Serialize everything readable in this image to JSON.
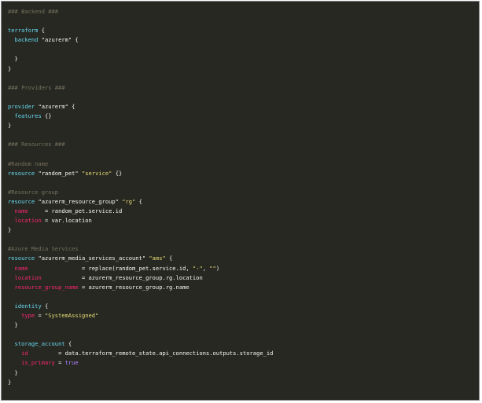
{
  "colors": {
    "background": "#272822",
    "border": "#8a8a8a",
    "plain": "#f8f8f2",
    "comment": "#75715e",
    "keyword": "#66d9ef",
    "string": "#e6db74",
    "attribute": "#f92672",
    "boolean": "#ae81ff"
  },
  "code_lines": [
    [
      {
        "t": "comment",
        "v": "### Backend ###"
      }
    ],
    [],
    [
      {
        "t": "keyword",
        "v": "terraform"
      },
      {
        "t": "plain",
        "v": " {"
      }
    ],
    [
      {
        "t": "plain",
        "v": "  "
      },
      {
        "t": "keyword",
        "v": "backend"
      },
      {
        "t": "plain",
        "v": " "
      },
      {
        "t": "plain",
        "v": "\"azurerm\""
      },
      {
        "t": "plain",
        "v": " {"
      }
    ],
    [],
    [
      {
        "t": "plain",
        "v": "  }"
      }
    ],
    [
      {
        "t": "plain",
        "v": "}"
      }
    ],
    [],
    [
      {
        "t": "comment",
        "v": "### Providers ###"
      }
    ],
    [],
    [
      {
        "t": "keyword",
        "v": "provider"
      },
      {
        "t": "plain",
        "v": " "
      },
      {
        "t": "plain",
        "v": "\"azurerm\""
      },
      {
        "t": "plain",
        "v": " {"
      }
    ],
    [
      {
        "t": "plain",
        "v": "  "
      },
      {
        "t": "keyword",
        "v": "features"
      },
      {
        "t": "plain",
        "v": " {}"
      }
    ],
    [
      {
        "t": "plain",
        "v": "}"
      }
    ],
    [],
    [
      {
        "t": "comment",
        "v": "### Resources ###"
      }
    ],
    [],
    [
      {
        "t": "comment",
        "v": "#Random name"
      }
    ],
    [
      {
        "t": "keyword",
        "v": "resource"
      },
      {
        "t": "plain",
        "v": " "
      },
      {
        "t": "plain",
        "v": "\"random_pet\""
      },
      {
        "t": "plain",
        "v": " "
      },
      {
        "t": "string",
        "v": "\"service\""
      },
      {
        "t": "plain",
        "v": " {}"
      }
    ],
    [],
    [
      {
        "t": "comment",
        "v": "#Resource group"
      }
    ],
    [
      {
        "t": "keyword",
        "v": "resource"
      },
      {
        "t": "plain",
        "v": " "
      },
      {
        "t": "plain",
        "v": "\"azurerm_resource_group\""
      },
      {
        "t": "plain",
        "v": " "
      },
      {
        "t": "string",
        "v": "\"rg\""
      },
      {
        "t": "plain",
        "v": " {"
      }
    ],
    [
      {
        "t": "plain",
        "v": "  "
      },
      {
        "t": "attr",
        "v": "name"
      },
      {
        "t": "plain",
        "v": "     = random_pet.service.id"
      }
    ],
    [
      {
        "t": "plain",
        "v": "  "
      },
      {
        "t": "attr",
        "v": "location"
      },
      {
        "t": "plain",
        "v": " = var.location"
      }
    ],
    [
      {
        "t": "plain",
        "v": "}"
      }
    ],
    [],
    [
      {
        "t": "comment",
        "v": "#Azure Media Services"
      }
    ],
    [
      {
        "t": "keyword",
        "v": "resource"
      },
      {
        "t": "plain",
        "v": " "
      },
      {
        "t": "plain",
        "v": "\"azurerm_media_services_account\""
      },
      {
        "t": "plain",
        "v": " "
      },
      {
        "t": "string",
        "v": "\"ams\""
      },
      {
        "t": "plain",
        "v": " {"
      }
    ],
    [
      {
        "t": "plain",
        "v": "  "
      },
      {
        "t": "attr",
        "v": "name"
      },
      {
        "t": "plain",
        "v": "                = replace(random_pet.service.id, "
      },
      {
        "t": "string",
        "v": "\"-\""
      },
      {
        "t": "plain",
        "v": ", "
      },
      {
        "t": "string",
        "v": "\"\""
      },
      {
        "t": "plain",
        "v": ")"
      }
    ],
    [
      {
        "t": "plain",
        "v": "  "
      },
      {
        "t": "attr",
        "v": "location"
      },
      {
        "t": "plain",
        "v": "            = azurerm_resource_group.rg.location"
      }
    ],
    [
      {
        "t": "plain",
        "v": "  "
      },
      {
        "t": "attr",
        "v": "resource_group_name"
      },
      {
        "t": "plain",
        "v": " = azurerm_resource_group.rg.name"
      }
    ],
    [],
    [
      {
        "t": "plain",
        "v": "  "
      },
      {
        "t": "keyword",
        "v": "identity"
      },
      {
        "t": "plain",
        "v": " {"
      }
    ],
    [
      {
        "t": "plain",
        "v": "    "
      },
      {
        "t": "attr",
        "v": "type"
      },
      {
        "t": "plain",
        "v": " = "
      },
      {
        "t": "string",
        "v": "\"SystemAssigned\""
      }
    ],
    [
      {
        "t": "plain",
        "v": "  }"
      }
    ],
    [],
    [
      {
        "t": "plain",
        "v": "  "
      },
      {
        "t": "keyword",
        "v": "storage_account"
      },
      {
        "t": "plain",
        "v": " {"
      }
    ],
    [
      {
        "t": "plain",
        "v": "    "
      },
      {
        "t": "attr",
        "v": "id"
      },
      {
        "t": "plain",
        "v": "         = data.terraform_remote_state.api_connections.outputs.storage_id"
      }
    ],
    [
      {
        "t": "plain",
        "v": "    "
      },
      {
        "t": "attr",
        "v": "is_primary"
      },
      {
        "t": "plain",
        "v": " = "
      },
      {
        "t": "bool",
        "v": "true"
      }
    ],
    [
      {
        "t": "plain",
        "v": "  }"
      }
    ],
    [
      {
        "t": "plain",
        "v": "}"
      }
    ]
  ]
}
